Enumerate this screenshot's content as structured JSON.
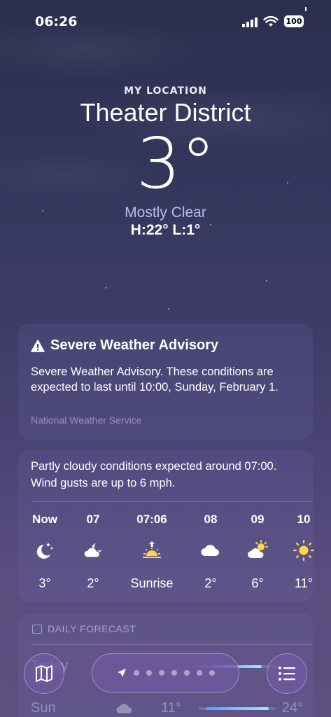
{
  "status_bar": {
    "time": "06:26",
    "battery": "100"
  },
  "hero": {
    "location_label": "MY LOCATION",
    "city": "Theater District",
    "temperature": "3°",
    "condition": "Mostly Clear",
    "high_low": "H:22°  L:1°"
  },
  "advisory": {
    "title": "Severe Weather Advisory",
    "body": "Severe Weather Advisory. These conditions are expected to last until 10:00, Sunday, February 1.",
    "source": "National Weather Service",
    "icon": "warning-triangle-icon"
  },
  "hourly": {
    "summary": "Partly cloudy conditions expected around 07:00. Wind gusts are up to 6 mph.",
    "hours": [
      {
        "label": "Now",
        "icon": "moon-stars-icon",
        "value": "3°"
      },
      {
        "label": "07",
        "icon": "cloud-moon-icon",
        "value": "2°"
      },
      {
        "label": "07:06",
        "icon": "sunrise-icon",
        "value": "Sunrise"
      },
      {
        "label": "08",
        "icon": "cloud-icon",
        "value": "2°"
      },
      {
        "label": "09",
        "icon": "cloud-sun-icon",
        "value": "6°"
      },
      {
        "label": "10",
        "icon": "sun-icon",
        "value": "11°"
      }
    ]
  },
  "daily": {
    "header": "DAILY FORECAST",
    "rows": [
      {
        "day": "Today",
        "low": "",
        "high": ""
      },
      {
        "day": "Sun",
        "low": "11°",
        "high": "24°",
        "icon": "cloud-icon"
      }
    ]
  },
  "colors": {
    "accent_blue": "#4fa3ff",
    "sun_yellow": "#ffd54a",
    "condition_text": "#b9bfe6"
  },
  "toolbar": {
    "page_count": 8,
    "current_page": 0
  }
}
